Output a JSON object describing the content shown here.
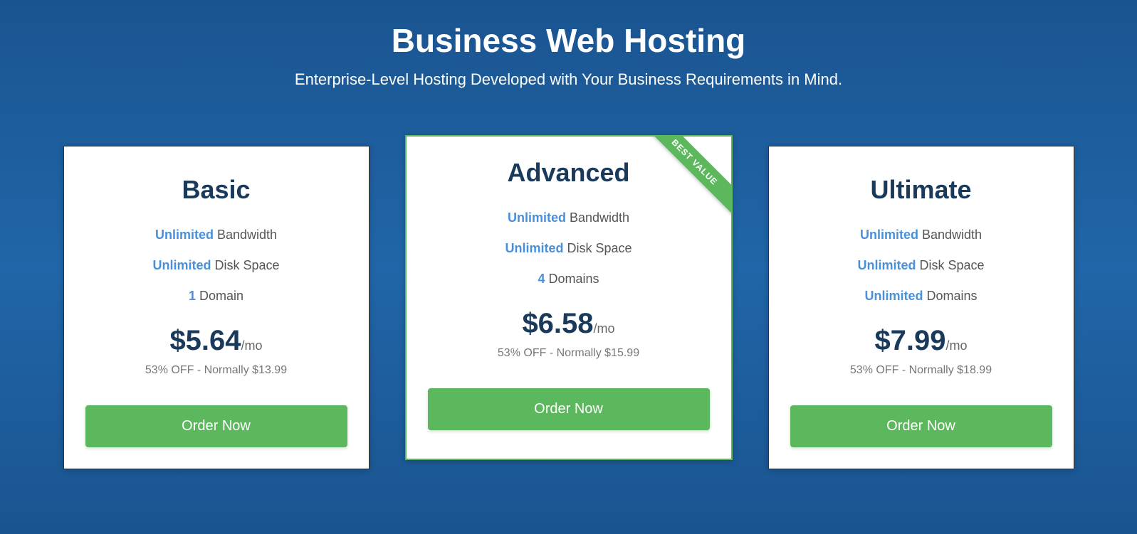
{
  "header": {
    "title": "Business Web Hosting",
    "subtitle": "Enterprise-Level Hosting Developed with Your Business Requirements in Mind."
  },
  "ribbon_text": "BEST VALUE",
  "plans": [
    {
      "name": "Basic",
      "f1_hl": "Unlimited",
      "f1_txt": " Bandwidth",
      "f2_hl": "Unlimited",
      "f2_txt": " Disk Space",
      "f3_hl": "1",
      "f3_txt": " Domain",
      "price": "$5.64",
      "period": "/mo",
      "discount": "53% OFF - Normally $13.99",
      "cta": "Order Now"
    },
    {
      "name": "Advanced",
      "f1_hl": "Unlimited",
      "f1_txt": " Bandwidth",
      "f2_hl": "Unlimited",
      "f2_txt": " Disk Space",
      "f3_hl": "4",
      "f3_txt": " Domains",
      "price": "$6.58",
      "period": "/mo",
      "discount": "53% OFF - Normally $15.99",
      "cta": "Order Now"
    },
    {
      "name": "Ultimate",
      "f1_hl": "Unlimited",
      "f1_txt": " Bandwidth",
      "f2_hl": "Unlimited",
      "f2_txt": " Disk Space",
      "f3_hl": "Unlimited",
      "f3_txt": " Domains",
      "price": "$7.99",
      "period": "/mo",
      "discount": "53% OFF - Normally $18.99",
      "cta": "Order Now"
    }
  ]
}
